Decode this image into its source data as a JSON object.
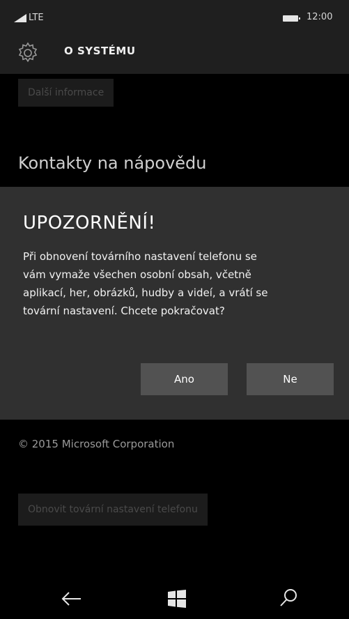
{
  "status": {
    "network": "LTE",
    "time": "12:00"
  },
  "header": {
    "title": "O SYSTÉMU",
    "icon": "gear-icon"
  },
  "background": {
    "more_info_label": "Další informace",
    "contacts_heading": "Kontakty na nápovědu",
    "copyright": "© 2015 Microsoft Corporation",
    "reset_label": "Obnovit tovární nastavení telefonu"
  },
  "dialog": {
    "title": "UPOZORNĚNÍ!",
    "lines": [
      "Při obnovení továrního nastavení telefonu se",
      "vám vymaže všechen osobní obsah, včetně",
      "aplikací, her, obrázků, hudby a videí, a vrátí se",
      "tovární nastavení. Chcete pokračovat?"
    ],
    "yes_label": "Ano",
    "no_label": "Ne"
  },
  "nav": {
    "back": "back-arrow-icon",
    "start": "windows-icon",
    "search": "search-icon"
  },
  "colors": {
    "dialog_bg": "#303030",
    "button_bg": "#525252",
    "bar_bg": "#1f1f1f"
  }
}
